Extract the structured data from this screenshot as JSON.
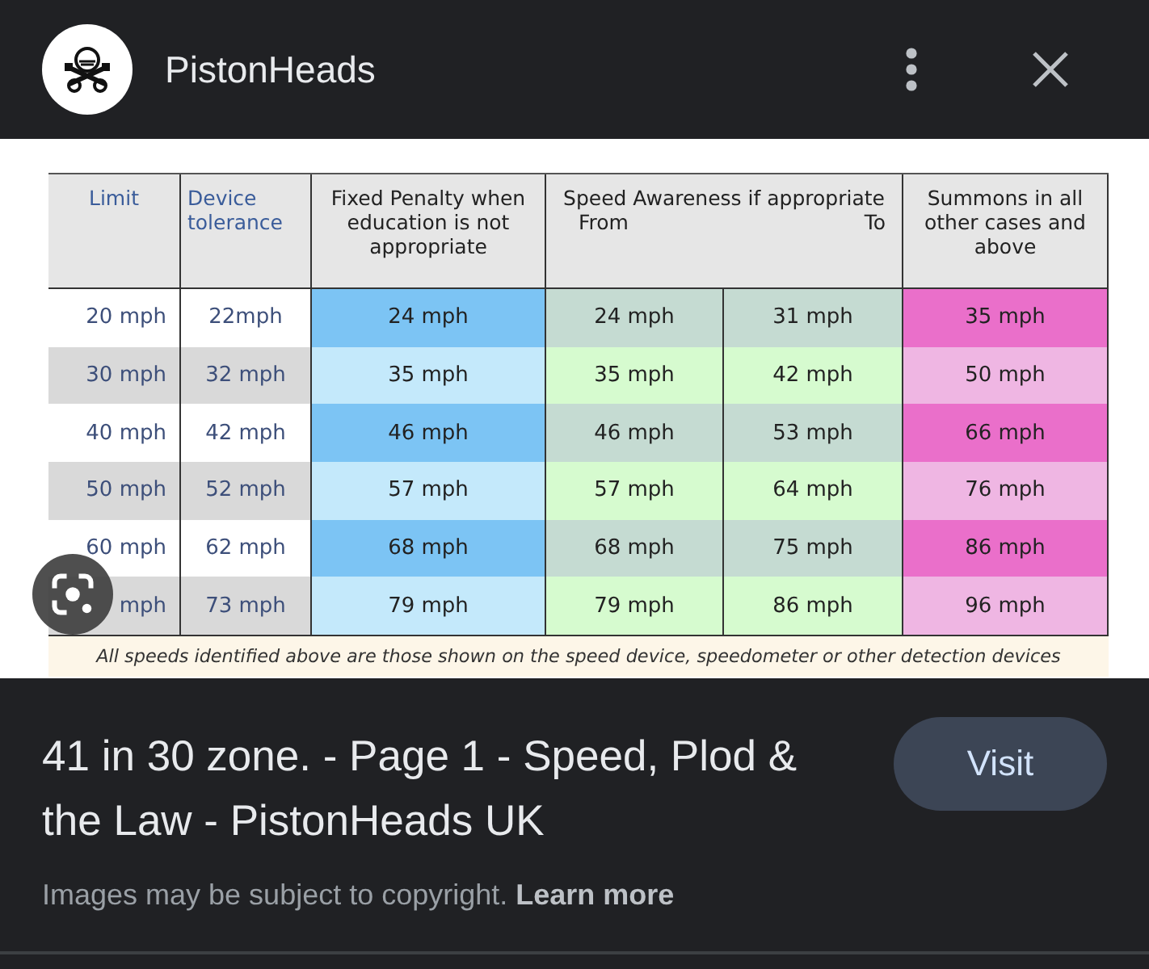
{
  "app_bar": {
    "site_name": "PistonHeads"
  },
  "table": {
    "headers": {
      "limit": "Limit",
      "tolerance": "Device tolerance",
      "fixed": "Fixed Penalty when education is not appropriate",
      "awareness": "Speed Awareness if appropriate",
      "from": "From",
      "to": "To",
      "summons": "Summons in all other cases and above"
    },
    "rows": [
      [
        "20 mph",
        "22mph",
        "24 mph",
        "24 mph",
        "31 mph",
        "35 mph"
      ],
      [
        "30 mph",
        "32 mph",
        "35 mph",
        "35 mph",
        "42 mph",
        "50 mph"
      ],
      [
        "40 mph",
        "42 mph",
        "46 mph",
        "46 mph",
        "53 mph",
        "66 mph"
      ],
      [
        "50 mph",
        "52 mph",
        "57 mph",
        "57 mph",
        "64 mph",
        "76 mph"
      ],
      [
        "60 mph",
        "62 mph",
        "68 mph",
        "68 mph",
        "75 mph",
        "86 mph"
      ],
      [
        "mph",
        "73 mph",
        "79 mph",
        "79 mph",
        "86 mph",
        "96 mph"
      ]
    ],
    "footnote": "All speeds identified above are those shown on the speed device, speedometer or other detection devices"
  },
  "result": {
    "title": "41 in 30 zone. - Page 1 - Speed, Plod & the Law - PistonHeads UK",
    "button": "Visit",
    "copyright": "Images may be subject to copyright.",
    "link": "Learn more"
  }
}
